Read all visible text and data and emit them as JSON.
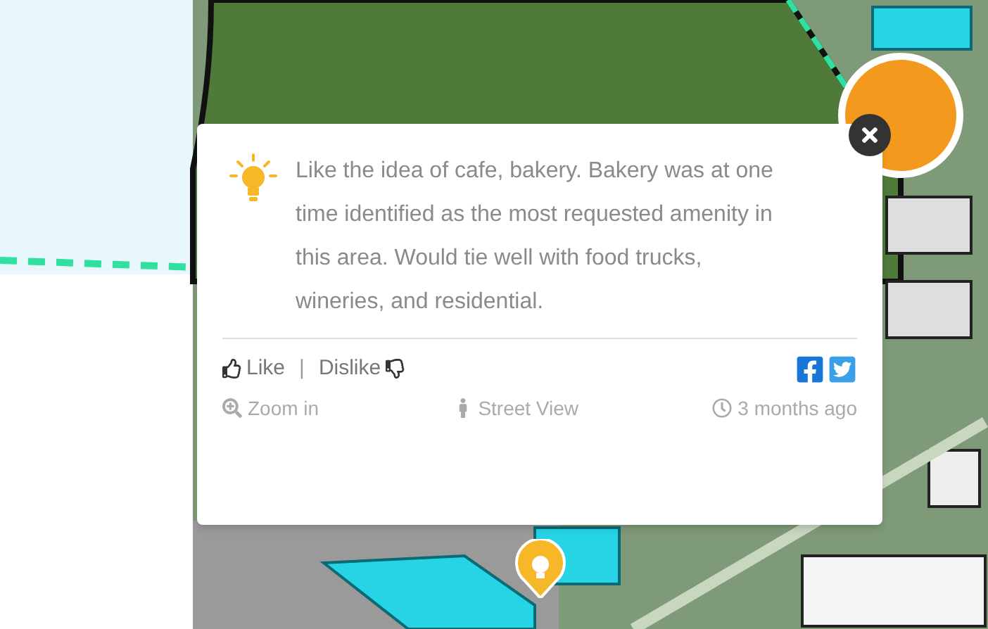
{
  "popup": {
    "comment": "Like the idea of cafe, bakery. Bakery was at one time identified as the most requested amenity in this area. Would tie well with food trucks, wineries, and residential.",
    "votes": [
      {
        "kind": "like",
        "label": "Like"
      },
      {
        "kind": "dislike",
        "label": "Dislike"
      }
    ],
    "separator": "|",
    "links": [
      {
        "kind": "zoom",
        "label": "Zoom in"
      },
      {
        "kind": "street",
        "label": "Street View"
      },
      {
        "kind": "time",
        "label": "3 months ago"
      }
    ]
  }
}
